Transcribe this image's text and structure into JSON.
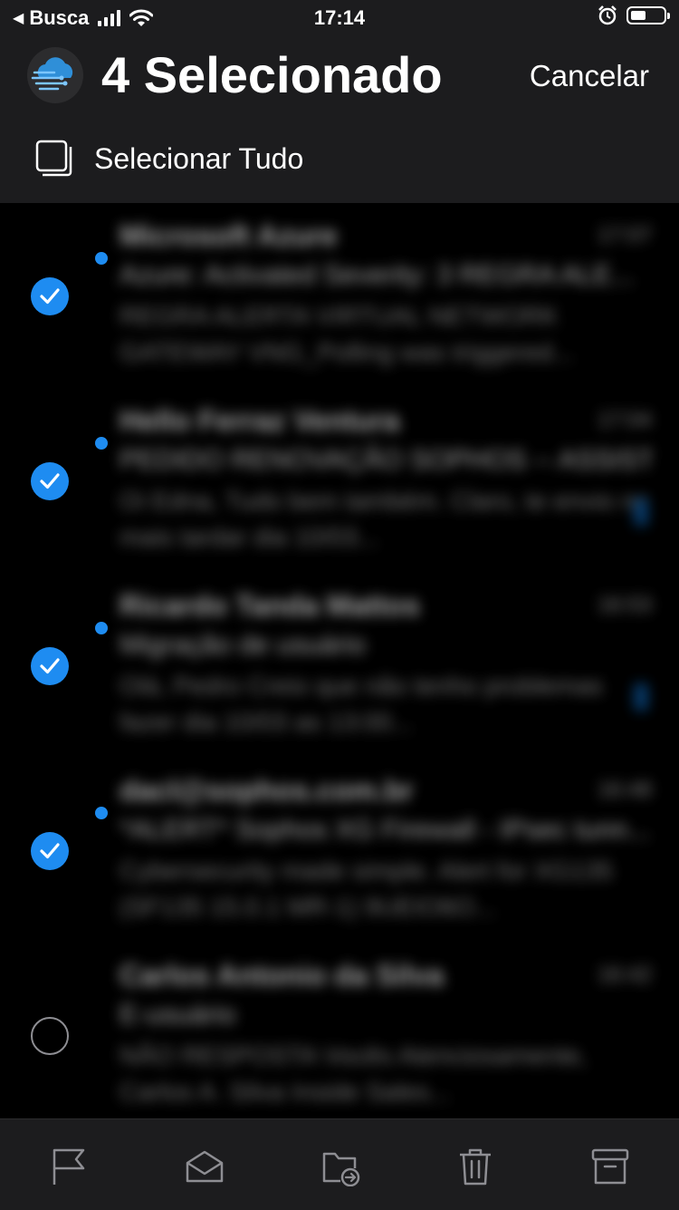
{
  "status_bar": {
    "back_label": "Busca",
    "time": "17:14",
    "icons": [
      "signal-icon",
      "wifi-icon",
      "alarm-icon",
      "battery-icon"
    ]
  },
  "header": {
    "title": "4 Selecionado",
    "cancel_label": "Cancelar",
    "select_all_label": "Selecionar Tudo"
  },
  "emails": [
    {
      "sender": "Microsoft Azure",
      "time": "17:07",
      "subject": "Azure: Activated Severity: 3 REGRA ALE...",
      "preview": "REGRA ALERTA VIRTUAL NETWORK GATEWAY VNG_Polling was triggered...",
      "selected": true,
      "unread": true,
      "flagged": false
    },
    {
      "sender": "Hello Ferraz Ventura",
      "time": "17:04",
      "subject": "PEDIDO RENOVAÇÃO SOPHOS -- ASSISTE...",
      "preview": "Oi Edna, Tudo bem também. Claro, te envio no mais tardar dia 10/03...",
      "selected": true,
      "unread": true,
      "flagged": true
    },
    {
      "sender": "Ricardo Tanda Mattos",
      "time": "16:53",
      "subject": "Migração de usuário",
      "preview": "Olá, Pedro Creio que não tenho problemas fazer dia 10/03 as 13:00...",
      "selected": true,
      "unread": true,
      "flagged": true
    },
    {
      "sender": "dacl@sophos.com.br",
      "time": "16:48",
      "subject": "*ALERT* Sophos XG Firewall - IPsec tunn...",
      "preview": "Cybersecurity made simple. Alert for XG135 (SF135 15.0.1 MR-1) 9UEIO6O...",
      "selected": true,
      "unread": true,
      "flagged": false
    },
    {
      "sender": "Carlos Antonio da Silva",
      "time": "16:42",
      "subject": "E-usuário",
      "preview": "NÃO RESPOSTA Vocês Atenciosamente, Carlos A. Silva Inside Sales...",
      "selected": false,
      "unread": false,
      "flagged": false
    }
  ],
  "toolbar": {
    "buttons": [
      "flag-icon",
      "mark-read-icon",
      "move-folder-icon",
      "trash-icon",
      "archive-icon"
    ]
  }
}
